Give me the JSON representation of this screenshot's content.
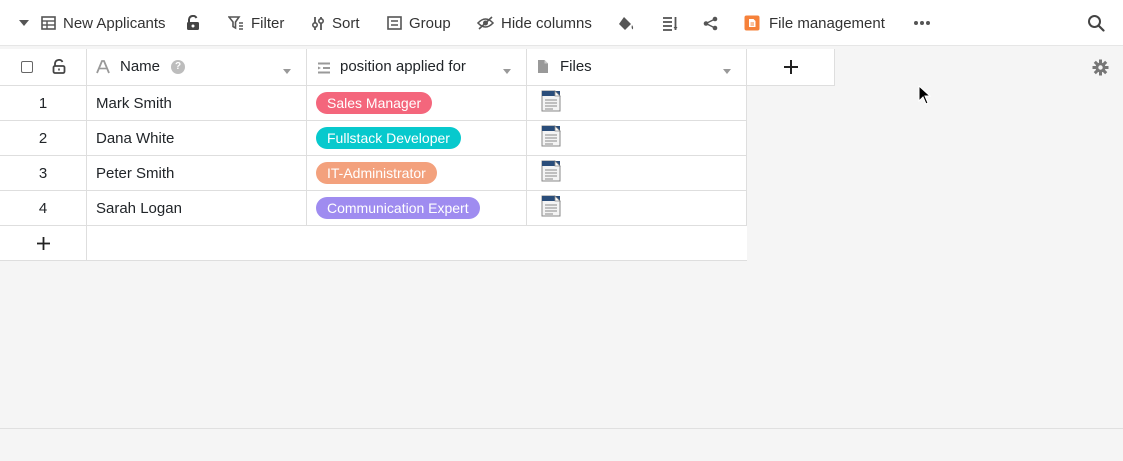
{
  "colors": {
    "pill_sales": "#f4667c",
    "pill_fullstack": "#07c9cd",
    "pill_it": "#f3a17d",
    "pill_comm": "#9f8cf0",
    "file_mgmt_icon": "#f6813a"
  },
  "toolbar": {
    "view_name": "New Applicants",
    "filter": "Filter",
    "sort": "Sort",
    "group": "Group",
    "hide_columns": "Hide columns",
    "file_management": "File management",
    "icons": [
      "chevron-down-icon",
      "table-icon",
      "lock-open-icon",
      "filter-icon",
      "sort-icon",
      "group-icon",
      "hide-columns-icon",
      "paint-bucket-icon",
      "row-height-icon",
      "share-icon",
      "file-management-icon",
      "more-icon",
      "search-icon"
    ]
  },
  "columns": [
    {
      "label": "Name",
      "icon": "text-type-icon"
    },
    {
      "label": "position applied for",
      "icon": "single-select-icon"
    },
    {
      "label": "Files",
      "icon": "file-icon"
    }
  ],
  "rows": [
    {
      "num": "1",
      "name": "Mark Smith",
      "position": "Sales Manager",
      "color_key": "pill_sales"
    },
    {
      "num": "2",
      "name": "Dana White",
      "position": "Fullstack Developer",
      "color_key": "pill_fullstack"
    },
    {
      "num": "3",
      "name": "Peter Smith",
      "position": "IT-Administrator",
      "color_key": "pill_it"
    },
    {
      "num": "4",
      "name": "Sarah Logan",
      "position": "Communication Expert",
      "color_key": "pill_comm"
    }
  ]
}
